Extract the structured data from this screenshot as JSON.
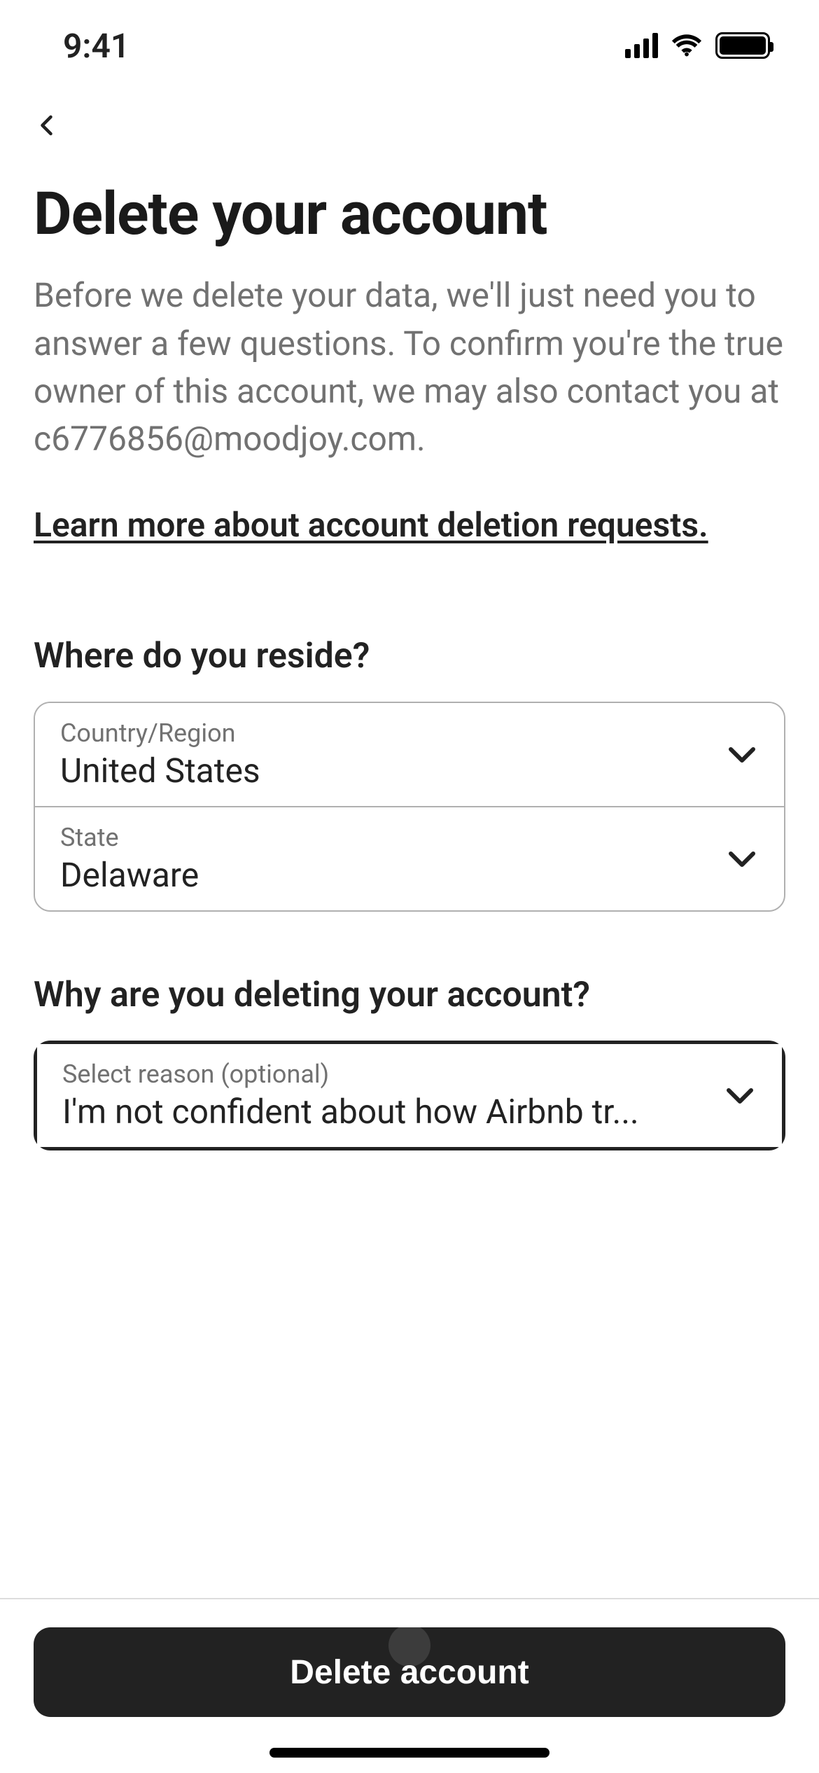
{
  "status": {
    "time": "9:41"
  },
  "page": {
    "title": "Delete your account",
    "desc_prefix": "Before we delete your data, we'll just need you to answer a few questions. To confirm you're the true owner of this account, we may also contact you at ",
    "email": "c6776856@moodjoy.com",
    "desc_suffix": ".",
    "learn_more": "Learn more about account deletion requests."
  },
  "residence": {
    "section_label": "Where do you reside?",
    "country": {
      "label": "Country/Region",
      "value": "United States"
    },
    "state": {
      "label": "State",
      "value": "Delaware"
    }
  },
  "reason": {
    "section_label": "Why are you deleting your account?",
    "label": "Select reason (optional)",
    "value": "I'm not confident about how Airbnb tr..."
  },
  "actions": {
    "delete": "Delete account"
  }
}
